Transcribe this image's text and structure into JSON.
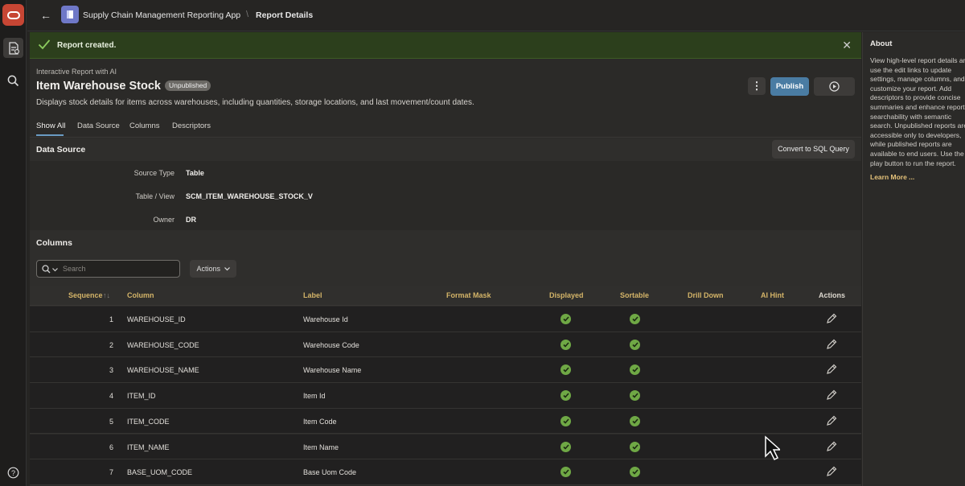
{
  "topbar": {
    "app_name": "Supply Chain Management Reporting App",
    "separator": "\\",
    "page": "Report Details"
  },
  "toast": {
    "message": "Report created."
  },
  "report": {
    "subtitle": "Interactive Report with AI",
    "title": "Item Warehouse Stock",
    "status": "Unpublished",
    "description": "Displays stock details for items across warehouses, including quantities, storage locations, and last movement/count dates.",
    "publish_label": "Publish",
    "more_label": "⋮"
  },
  "tabs": [
    "Show All",
    "Data Source",
    "Columns",
    "Descriptors"
  ],
  "data_source": {
    "heading": "Data Source",
    "convert_label": "Convert to SQL Query",
    "fields": [
      {
        "label": "Source Type",
        "value": "Table"
      },
      {
        "label": "Table / View",
        "value": "SCM_ITEM_WAREHOUSE_STOCK_V"
      },
      {
        "label": "Owner",
        "value": "DR"
      }
    ]
  },
  "columns": {
    "heading": "Columns",
    "search_placeholder": "Search",
    "actions_label": "Actions",
    "headers": {
      "sequence": "Sequence",
      "sort_arrow": "↑↓",
      "column": "Column",
      "label": "Label",
      "format_mask": "Format Mask",
      "displayed": "Displayed",
      "sortable": "Sortable",
      "drill_down": "Drill Down",
      "ai_hint": "AI Hint",
      "actions": "Actions"
    },
    "rows": [
      {
        "seq": "1",
        "column": "WAREHOUSE_ID",
        "label": "Warehouse Id"
      },
      {
        "seq": "2",
        "column": "WAREHOUSE_CODE",
        "label": "Warehouse Code"
      },
      {
        "seq": "3",
        "column": "WAREHOUSE_NAME",
        "label": "Warehouse Name"
      },
      {
        "seq": "4",
        "column": "ITEM_ID",
        "label": "Item Id"
      },
      {
        "seq": "5",
        "column": "ITEM_CODE",
        "label": "Item Code"
      },
      {
        "seq": "6",
        "column": "ITEM_NAME",
        "label": "Item Name"
      },
      {
        "seq": "7",
        "column": "BASE_UOM_CODE",
        "label": "Base Uom Code"
      }
    ]
  },
  "about": {
    "heading": "About",
    "text": "View high-level report details and use the edit links to update settings, manage columns, and customize your report. Add descriptors to provide concise summaries and enhance report searchability with semantic search. Unpublished reports are accessible only to developers, while published reports are available to end users. Use the play button to run the report.",
    "link": "Learn More ..."
  },
  "colors": {
    "accent": "#4a7ca3",
    "success": "#6fa845",
    "toast_bg": "#2c3f1c",
    "oracle_red": "#c74634",
    "header_gold": "#d4b468"
  }
}
